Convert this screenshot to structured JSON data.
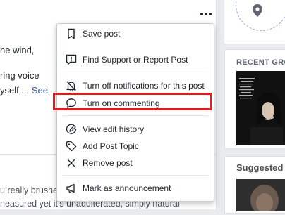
{
  "post": {
    "line1": "he wind,",
    "line2": "ring voice",
    "line3": "yself.... ",
    "see_more": "See",
    "comment1": "u really brushe",
    "comment2": "neasured yet it's unadulterated, simply natural"
  },
  "menu": {
    "items": [
      {
        "label": "Save post",
        "icon": "bookmark-icon"
      },
      {
        "label": "Find Support or Report Post",
        "icon": "report-icon"
      },
      {
        "label": "Turn off notifications for this post",
        "icon": "bell-off-icon"
      },
      {
        "label": "Turn on commenting",
        "icon": "comment-icon"
      },
      {
        "label": "View edit history",
        "icon": "pencil-history-icon"
      },
      {
        "label": "Add Post Topic",
        "icon": "tag-icon"
      },
      {
        "label": "Remove post",
        "icon": "close-icon"
      },
      {
        "label": "Mark as announcement",
        "icon": "megaphone-icon"
      }
    ]
  },
  "sidebar": {
    "recent_groups_title": "RECENT GRO",
    "suggested_title": "Suggested"
  },
  "colors": {
    "highlight": "#e11b1b",
    "link": "#385898",
    "background": "#e9ebee"
  }
}
